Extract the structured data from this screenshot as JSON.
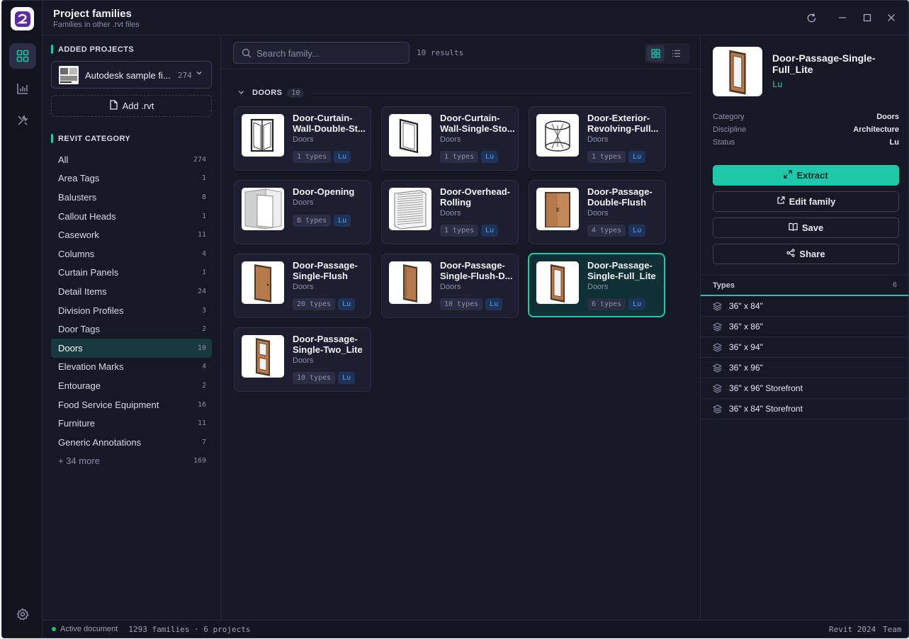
{
  "window": {
    "title": "Project families",
    "subtitle": "Families in other .rvt files"
  },
  "rail": {
    "items": [
      "grid-icon",
      "chart-icon",
      "tools-icon",
      "settings-icon"
    ]
  },
  "sidebar": {
    "added_heading": "ADDED PROJECTS",
    "project": {
      "name": "Autodesk sample fi...",
      "count": "274"
    },
    "add_label": "Add .rvt",
    "category_heading": "REVIT CATEGORY",
    "categories": [
      {
        "label": "All",
        "count": "274"
      },
      {
        "label": "Area Tags",
        "count": "1"
      },
      {
        "label": "Balusters",
        "count": "8"
      },
      {
        "label": "Callout Heads",
        "count": "1"
      },
      {
        "label": "Casework",
        "count": "11"
      },
      {
        "label": "Columns",
        "count": "4"
      },
      {
        "label": "Curtain Panels",
        "count": "1"
      },
      {
        "label": "Detail Items",
        "count": "24"
      },
      {
        "label": "Division Profiles",
        "count": "3"
      },
      {
        "label": "Door Tags",
        "count": "2"
      },
      {
        "label": "Doors",
        "count": "10"
      },
      {
        "label": "Elevation Marks",
        "count": "4"
      },
      {
        "label": "Entourage",
        "count": "2"
      },
      {
        "label": "Food Service Equipment",
        "count": "16"
      },
      {
        "label": "Furniture",
        "count": "11"
      },
      {
        "label": "Generic Annotations",
        "count": "7"
      },
      {
        "label": "+ 34 more",
        "count": "169"
      }
    ],
    "selected_category": "Doors"
  },
  "main": {
    "search_placeholder": "Search family...",
    "results": "10 results",
    "group": {
      "label": "DOORS",
      "count": "10"
    },
    "cards": [
      {
        "name": "Door-Curtain-Wall-Double-St...",
        "category": "Doors",
        "types": "1 types",
        "status": "Lu"
      },
      {
        "name": "Door-Curtain-Wall-Single-Sto...",
        "category": "Doors",
        "types": "1 types",
        "status": "Lu"
      },
      {
        "name": "Door-Exterior-Revolving-Full...",
        "category": "Doors",
        "types": "1 types",
        "status": "Lu"
      },
      {
        "name": "Door-Opening",
        "category": "Doors",
        "types": "8 types",
        "status": "Lu"
      },
      {
        "name": "Door-Overhead-Rolling",
        "category": "Doors",
        "types": "1 types",
        "status": "Lu"
      },
      {
        "name": "Door-Passage-Double-Flush",
        "category": "Doors",
        "types": "4 types",
        "status": "Lu"
      },
      {
        "name": "Door-Passage-Single-Flush",
        "category": "Doors",
        "types": "20 types",
        "status": "Lu"
      },
      {
        "name": "Door-Passage-Single-Flush-D...",
        "category": "Doors",
        "types": "10 types",
        "status": "Lu"
      },
      {
        "name": "Door-Passage-Single-Full_Lite",
        "category": "Doors",
        "types": "6 types",
        "status": "Lu"
      },
      {
        "name": "Door-Passage-Single-Two_Lite",
        "category": "Doors",
        "types": "10 types",
        "status": "Lu"
      }
    ]
  },
  "detail": {
    "name": "Door-Passage-Single-Full_Lite",
    "status": "Lu",
    "props": [
      {
        "key": "Category",
        "value": "Doors"
      },
      {
        "key": "Discipline",
        "value": "Architecture"
      },
      {
        "key": "Status",
        "value": "Lu"
      }
    ],
    "buttons": {
      "extract": "Extract",
      "edit": "Edit family",
      "save": "Save",
      "share": "Share"
    },
    "types_heading": "Types",
    "types_count": "6",
    "types": [
      "36\" x 84\"",
      "36\" x 86\"",
      "36\" x 94\"",
      "36\" x 96\"",
      "36\" x 96\" Storefront",
      "36\" x 84\" Storefront"
    ]
  },
  "status": {
    "active": "Active document",
    "summary": "1293 families · 6 projects",
    "version": "Revit 2024",
    "team": "Team"
  },
  "colors": {
    "accent": "#1fc8a9",
    "background": "#161826",
    "tag_lu": "#5ea0f2"
  }
}
